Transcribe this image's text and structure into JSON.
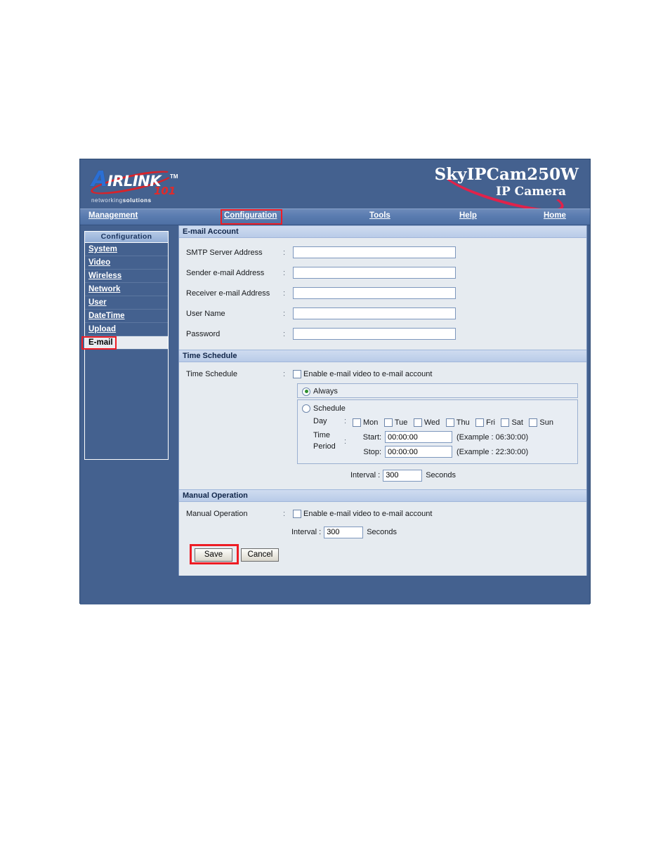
{
  "brand": {
    "logo_letter": "A",
    "logo_word": "IRLINK",
    "logo_tm": "TM",
    "logo_101": "101",
    "logo_tagline_light": "networking",
    "logo_tagline_bold": "solutions",
    "product_name": "SkyIPCam250W",
    "product_sub": "IP Camera"
  },
  "nav": {
    "items": [
      {
        "label": "Management",
        "highlighted": false
      },
      {
        "label": "Configuration",
        "highlighted": true
      },
      {
        "label": "Tools",
        "highlighted": false
      },
      {
        "label": "Help",
        "highlighted": false
      },
      {
        "label": "Home",
        "highlighted": false
      }
    ]
  },
  "sidebar": {
    "title": "Configuration",
    "items": [
      {
        "label": "System",
        "active": false
      },
      {
        "label": "Video",
        "active": false
      },
      {
        "label": "Wireless",
        "active": false
      },
      {
        "label": "Network",
        "active": false
      },
      {
        "label": "User",
        "active": false
      },
      {
        "label": "DateTime",
        "active": false
      },
      {
        "label": "Upload",
        "active": false
      },
      {
        "label": "E-mail",
        "active": true
      }
    ]
  },
  "email_account": {
    "section_title": "E-mail Account",
    "colon": ":",
    "fields": [
      {
        "label": "SMTP Server Address",
        "value": ""
      },
      {
        "label": "Sender e-mail Address",
        "value": ""
      },
      {
        "label": "Receiver e-mail Address",
        "value": ""
      },
      {
        "label": "User Name",
        "value": ""
      },
      {
        "label": "Password",
        "value": ""
      }
    ]
  },
  "time_schedule": {
    "section_title": "Time Schedule",
    "row_label": "Time Schedule",
    "colon": ":",
    "enable_label": "Enable e-mail video to e-mail account",
    "enable_checked": false,
    "mode_always_label": "Always",
    "mode_schedule_label": "Schedule",
    "mode_selected": "Always",
    "day_label": "Day",
    "time_label_line1": "Time",
    "time_label_line2": "Period",
    "days": [
      {
        "label": "Mon",
        "checked": false
      },
      {
        "label": "Tue",
        "checked": false
      },
      {
        "label": "Wed",
        "checked": false
      },
      {
        "label": "Thu",
        "checked": false
      },
      {
        "label": "Fri",
        "checked": false
      },
      {
        "label": "Sat",
        "checked": false
      },
      {
        "label": "Sun",
        "checked": false
      }
    ],
    "start_label": "Start",
    "start_value": "00:00:00",
    "start_example": "(Example : 06:30:00)",
    "stop_label": "Stop",
    "stop_value": "00:00:00",
    "stop_example": "(Example : 22:30:00)",
    "interval_label": "Interval :",
    "interval_value": "300",
    "interval_unit": "Seconds"
  },
  "manual_operation": {
    "section_title": "Manual Operation",
    "row_label": "Manual Operation",
    "colon": ":",
    "enable_label": "Enable e-mail video to e-mail account",
    "enable_checked": false,
    "interval_label": "Interval :",
    "interval_value": "300",
    "interval_unit": "Seconds"
  },
  "buttons": {
    "save_label": "Save",
    "cancel_label": "Cancel",
    "save_highlighted": true
  },
  "colors": {
    "frame_blue": "#44618f",
    "nav_blue": "#5a7cb0",
    "section_header": "#b9cbe8",
    "content_bg": "#e6ebf0",
    "highlight_red": "#ee1c24",
    "logo_red": "#e02b2b",
    "radio_green": "#2f8f2f"
  }
}
